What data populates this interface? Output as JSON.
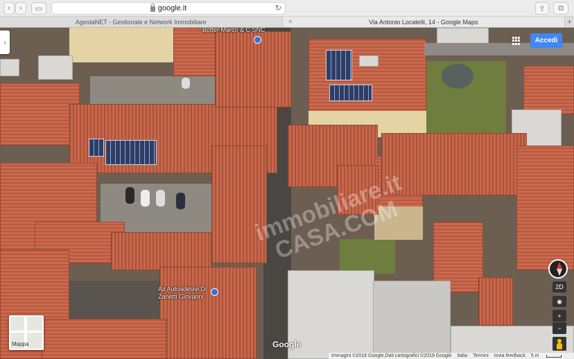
{
  "browser": {
    "url": "google.it",
    "tabs": [
      {
        "title": "AgestaNET - Gestionale e Network Immobiliare",
        "active": false
      },
      {
        "title": "Via Antonio Locatelli, 14 - Google Maps",
        "active": true
      }
    ],
    "new_tab": "+"
  },
  "map": {
    "place_labels": [
      {
        "text": "Botter Marco & C SNC"
      },
      {
        "text": "Az Autoadesivi Di\nZanetti Giovanni"
      }
    ],
    "sign_in": "Accedi",
    "minimap_label": "Mappa",
    "google_logo": "Google",
    "footer": {
      "imagery": "Immagini ©2018 Google,Dati cartografici ©2018 Google",
      "country": "Italia",
      "terms": "Termini",
      "feedback": "Invia feedback",
      "scale": "5 m"
    },
    "controls": {
      "mode": "2D",
      "zoom_in": "+",
      "zoom_out": "−",
      "locate": "◉"
    },
    "watermark": "immobiliare.it\nCASA.COM"
  }
}
